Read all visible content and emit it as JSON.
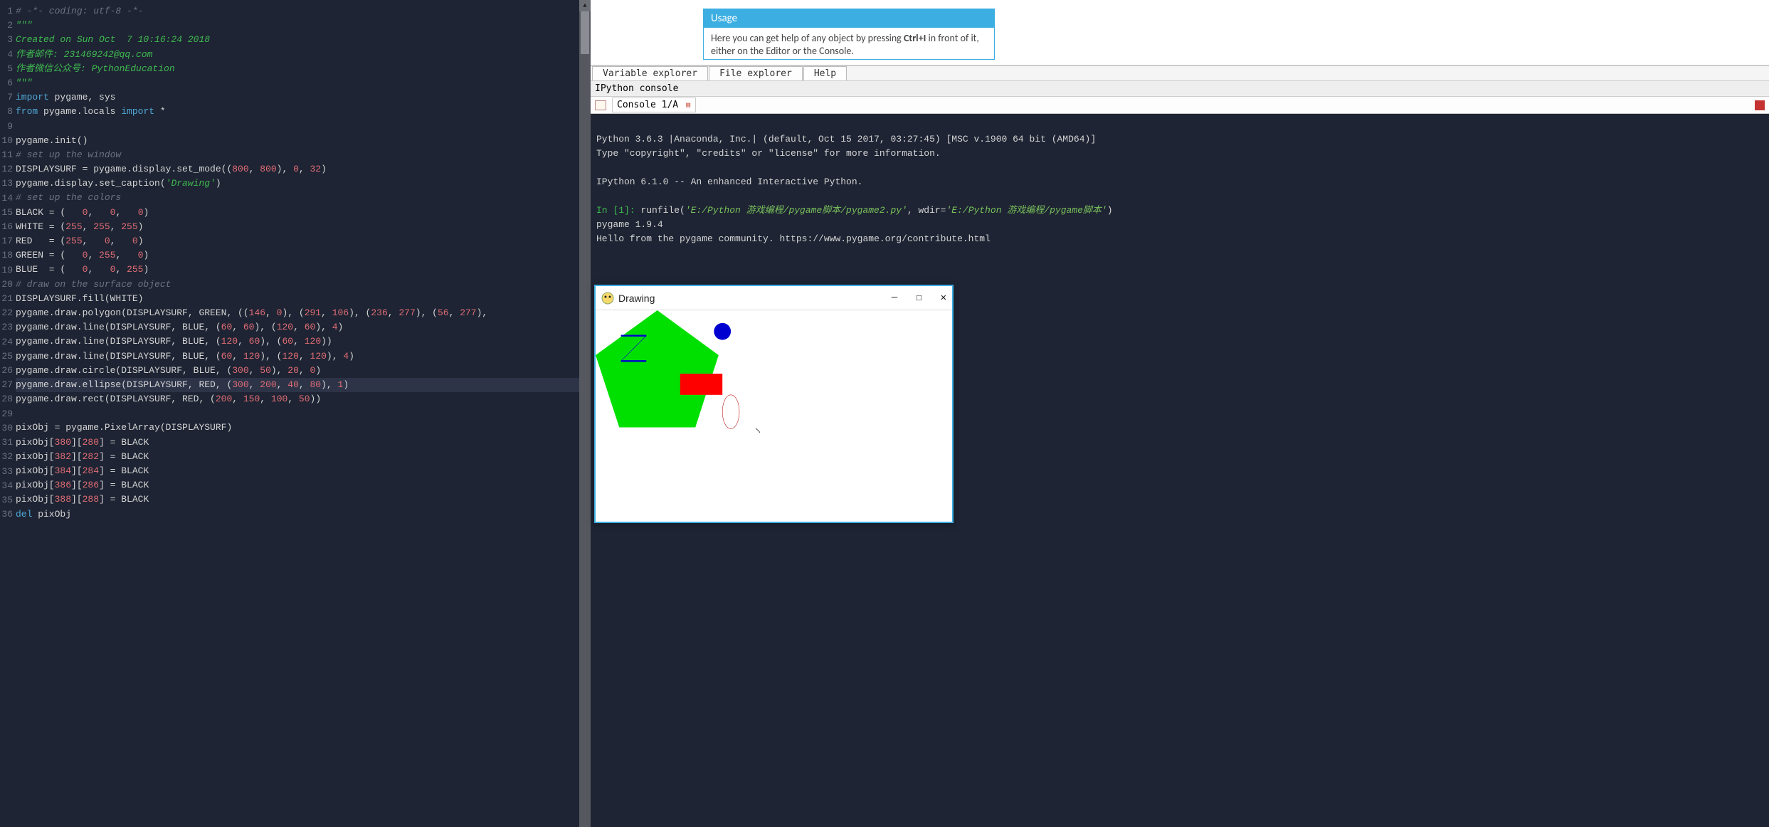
{
  "editor": {
    "highlighted_line": 27,
    "lines": [
      {
        "n": 1,
        "tokens": [
          [
            "comment",
            "# -*- coding: utf-8 -*-"
          ]
        ]
      },
      {
        "n": 2,
        "tokens": [
          [
            "string",
            "\"\"\""
          ]
        ]
      },
      {
        "n": 3,
        "tokens": [
          [
            "string",
            "Created on Sun Oct  7 10:16:24 2018"
          ]
        ]
      },
      {
        "n": 4,
        "tokens": [
          [
            "string",
            "作者邮件: 231469242@qq.com"
          ]
        ]
      },
      {
        "n": 5,
        "tokens": [
          [
            "string",
            "作者微信公众号: PythonEducation"
          ]
        ]
      },
      {
        "n": 6,
        "tokens": [
          [
            "string",
            "\"\"\""
          ]
        ]
      },
      {
        "n": 7,
        "tokens": [
          [
            "keyword",
            "import"
          ],
          [
            "default",
            " pygame, sys"
          ]
        ]
      },
      {
        "n": 8,
        "tokens": [
          [
            "keyword",
            "from"
          ],
          [
            "default",
            " pygame.locals "
          ],
          [
            "keyword",
            "import"
          ],
          [
            "default",
            " *"
          ]
        ]
      },
      {
        "n": 9,
        "tokens": []
      },
      {
        "n": 10,
        "tokens": [
          [
            "default",
            "pygame.init()"
          ]
        ]
      },
      {
        "n": 11,
        "tokens": [
          [
            "comment",
            "# set up the window"
          ]
        ]
      },
      {
        "n": 12,
        "tokens": [
          [
            "default",
            "DISPLAYSURF = pygame.display.set_mode(("
          ],
          [
            "num",
            "800"
          ],
          [
            "default",
            ", "
          ],
          [
            "num",
            "800"
          ],
          [
            "default",
            "), "
          ],
          [
            "num",
            "0"
          ],
          [
            "default",
            ", "
          ],
          [
            "num",
            "32"
          ],
          [
            "default",
            ")"
          ]
        ]
      },
      {
        "n": 13,
        "tokens": [
          [
            "default",
            "pygame.display.set_caption("
          ],
          [
            "string",
            "'Drawing'"
          ],
          [
            "default",
            ")"
          ]
        ]
      },
      {
        "n": 14,
        "tokens": [
          [
            "comment",
            "# set up the colors"
          ]
        ]
      },
      {
        "n": 15,
        "tokens": [
          [
            "default",
            "BLACK = (   "
          ],
          [
            "num",
            "0"
          ],
          [
            "default",
            ",   "
          ],
          [
            "num",
            "0"
          ],
          [
            "default",
            ",   "
          ],
          [
            "num",
            "0"
          ],
          [
            "default",
            ")"
          ]
        ]
      },
      {
        "n": 16,
        "tokens": [
          [
            "default",
            "WHITE = ("
          ],
          [
            "num",
            "255"
          ],
          [
            "default",
            ", "
          ],
          [
            "num",
            "255"
          ],
          [
            "default",
            ", "
          ],
          [
            "num",
            "255"
          ],
          [
            "default",
            ")"
          ]
        ]
      },
      {
        "n": 17,
        "tokens": [
          [
            "default",
            "RED   = ("
          ],
          [
            "num",
            "255"
          ],
          [
            "default",
            ",   "
          ],
          [
            "num",
            "0"
          ],
          [
            "default",
            ",   "
          ],
          [
            "num",
            "0"
          ],
          [
            "default",
            ")"
          ]
        ]
      },
      {
        "n": 18,
        "tokens": [
          [
            "default",
            "GREEN = (   "
          ],
          [
            "num",
            "0"
          ],
          [
            "default",
            ", "
          ],
          [
            "num",
            "255"
          ],
          [
            "default",
            ",   "
          ],
          [
            "num",
            "0"
          ],
          [
            "default",
            ")"
          ]
        ]
      },
      {
        "n": 19,
        "tokens": [
          [
            "default",
            "BLUE  = (   "
          ],
          [
            "num",
            "0"
          ],
          [
            "default",
            ",   "
          ],
          [
            "num",
            "0"
          ],
          [
            "default",
            ", "
          ],
          [
            "num",
            "255"
          ],
          [
            "default",
            ")"
          ]
        ]
      },
      {
        "n": 20,
        "tokens": [
          [
            "comment",
            "# draw on the surface object"
          ]
        ]
      },
      {
        "n": 21,
        "tokens": [
          [
            "default",
            "DISPLAYSURF.fill(WHITE)"
          ]
        ]
      },
      {
        "n": 22,
        "tokens": [
          [
            "default",
            "pygame.draw.polygon(DISPLAYSURF, GREEN, (("
          ],
          [
            "num",
            "146"
          ],
          [
            "default",
            ", "
          ],
          [
            "num",
            "0"
          ],
          [
            "default",
            "), ("
          ],
          [
            "num",
            "291"
          ],
          [
            "default",
            ", "
          ],
          [
            "num",
            "106"
          ],
          [
            "default",
            "), ("
          ],
          [
            "num",
            "236"
          ],
          [
            "default",
            ", "
          ],
          [
            "num",
            "277"
          ],
          [
            "default",
            "), ("
          ],
          [
            "num",
            "56"
          ],
          [
            "default",
            ", "
          ],
          [
            "num",
            "277"
          ],
          [
            "default",
            "),"
          ]
        ]
      },
      {
        "n": 23,
        "tokens": [
          [
            "default",
            "pygame.draw.line(DISPLAYSURF, BLUE, ("
          ],
          [
            "num",
            "60"
          ],
          [
            "default",
            ", "
          ],
          [
            "num",
            "60"
          ],
          [
            "default",
            "), ("
          ],
          [
            "num",
            "120"
          ],
          [
            "default",
            ", "
          ],
          [
            "num",
            "60"
          ],
          [
            "default",
            "), "
          ],
          [
            "num",
            "4"
          ],
          [
            "default",
            ")"
          ]
        ]
      },
      {
        "n": 24,
        "tokens": [
          [
            "default",
            "pygame.draw.line(DISPLAYSURF, BLUE, ("
          ],
          [
            "num",
            "120"
          ],
          [
            "default",
            ", "
          ],
          [
            "num",
            "60"
          ],
          [
            "default",
            "), ("
          ],
          [
            "num",
            "60"
          ],
          [
            "default",
            ", "
          ],
          [
            "num",
            "120"
          ],
          [
            "default",
            "))"
          ]
        ]
      },
      {
        "n": 25,
        "tokens": [
          [
            "default",
            "pygame.draw.line(DISPLAYSURF, BLUE, ("
          ],
          [
            "num",
            "60"
          ],
          [
            "default",
            ", "
          ],
          [
            "num",
            "120"
          ],
          [
            "default",
            "), ("
          ],
          [
            "num",
            "120"
          ],
          [
            "default",
            ", "
          ],
          [
            "num",
            "120"
          ],
          [
            "default",
            "), "
          ],
          [
            "num",
            "4"
          ],
          [
            "default",
            ")"
          ]
        ]
      },
      {
        "n": 26,
        "tokens": [
          [
            "default",
            "pygame.draw.circle(DISPLAYSURF, BLUE, ("
          ],
          [
            "num",
            "300"
          ],
          [
            "default",
            ", "
          ],
          [
            "num",
            "50"
          ],
          [
            "default",
            "), "
          ],
          [
            "num",
            "20"
          ],
          [
            "default",
            ", "
          ],
          [
            "num",
            "0"
          ],
          [
            "default",
            ")"
          ]
        ]
      },
      {
        "n": 27,
        "tokens": [
          [
            "default",
            "pygame.draw.ellipse(DISPLAYSURF, RED, ("
          ],
          [
            "num",
            "300"
          ],
          [
            "default",
            ", "
          ],
          [
            "num",
            "200"
          ],
          [
            "default",
            ", "
          ],
          [
            "num",
            "40"
          ],
          [
            "default",
            ", "
          ],
          [
            "num",
            "80"
          ],
          [
            "default",
            "), "
          ],
          [
            "num",
            "1"
          ],
          [
            "default",
            ")"
          ]
        ]
      },
      {
        "n": 28,
        "tokens": [
          [
            "default",
            "pygame.draw.rect(DISPLAYSURF, RED, ("
          ],
          [
            "num",
            "200"
          ],
          [
            "default",
            ", "
          ],
          [
            "num",
            "150"
          ],
          [
            "default",
            ", "
          ],
          [
            "num",
            "100"
          ],
          [
            "default",
            ", "
          ],
          [
            "num",
            "50"
          ],
          [
            "default",
            "))"
          ]
        ]
      },
      {
        "n": 29,
        "tokens": []
      },
      {
        "n": 30,
        "tokens": [
          [
            "default",
            "pixObj = pygame.PixelArray(DISPLAYSURF)"
          ]
        ]
      },
      {
        "n": 31,
        "tokens": [
          [
            "default",
            "pixObj["
          ],
          [
            "num",
            "380"
          ],
          [
            "default",
            "]["
          ],
          [
            "num",
            "280"
          ],
          [
            "default",
            "] = BLACK"
          ]
        ]
      },
      {
        "n": 32,
        "tokens": [
          [
            "default",
            "pixObj["
          ],
          [
            "num",
            "382"
          ],
          [
            "default",
            "]["
          ],
          [
            "num",
            "282"
          ],
          [
            "default",
            "] = BLACK"
          ]
        ]
      },
      {
        "n": 33,
        "tokens": [
          [
            "default",
            "pixObj["
          ],
          [
            "num",
            "384"
          ],
          [
            "default",
            "]["
          ],
          [
            "num",
            "284"
          ],
          [
            "default",
            "] = BLACK"
          ]
        ]
      },
      {
        "n": 34,
        "tokens": [
          [
            "default",
            "pixObj["
          ],
          [
            "num",
            "386"
          ],
          [
            "default",
            "]["
          ],
          [
            "num",
            "286"
          ],
          [
            "default",
            "] = BLACK"
          ]
        ]
      },
      {
        "n": 35,
        "tokens": [
          [
            "default",
            "pixObj["
          ],
          [
            "num",
            "388"
          ],
          [
            "default",
            "]["
          ],
          [
            "num",
            "288"
          ],
          [
            "default",
            "] = BLACK"
          ]
        ]
      },
      {
        "n": 36,
        "tokens": [
          [
            "keyword",
            "del"
          ],
          [
            "default",
            " pixObj"
          ]
        ]
      }
    ]
  },
  "help_panel": {
    "usage_title": "Usage",
    "usage_body_prefix": "Here you can get help of any object by pressing ",
    "usage_body_shortcut": "Ctrl+I",
    "usage_body_suffix": " in front of it, either on the Editor or the Console."
  },
  "tabs": {
    "variable_explorer": "Variable explorer",
    "file_explorer": "File explorer",
    "help": "Help"
  },
  "console": {
    "title": "IPython console",
    "tab_label": "Console 1/A",
    "banner_line1": "Python 3.6.3 |Anaconda, Inc.| (default, Oct 15 2017, 03:27:45) [MSC v.1900 64 bit (AMD64)]",
    "banner_line2": "Type \"copyright\", \"credits\" or \"license\" for more information.",
    "banner_line3": "IPython 6.1.0 -- An enhanced Interactive Python.",
    "prompt": "In [1]:",
    "cmd_prefix": " runfile(",
    "cmd_arg1": "'E:/Python 游戏编程/pygame脚本/pygame2.py'",
    "cmd_mid": ", wdir=",
    "cmd_arg2": "'E:/Python 游戏编程/pygame脚本'",
    "cmd_suffix": ")",
    "out_line1": "pygame 1.9.4",
    "out_line2": "Hello from the pygame community. https://www.pygame.org/contribute.html"
  },
  "drawing_window": {
    "title": "Drawing",
    "minimize": "—",
    "maximize": "☐",
    "close": "✕"
  }
}
